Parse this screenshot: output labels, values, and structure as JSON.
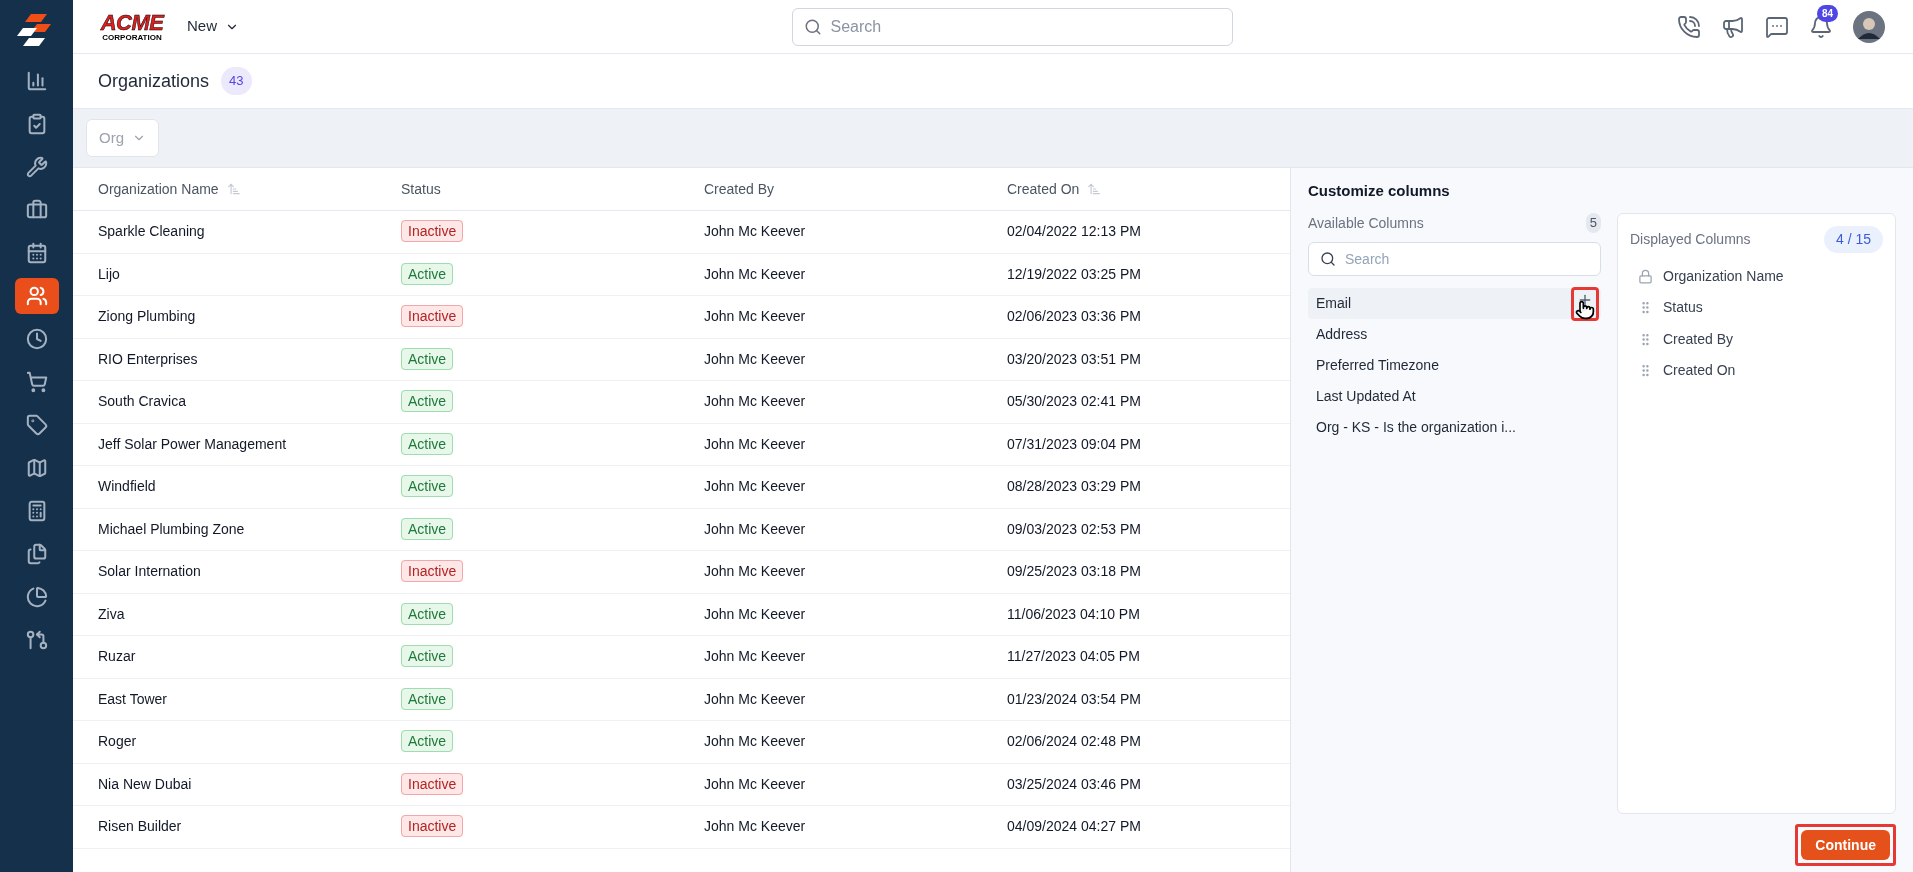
{
  "sidebar": {
    "items": [
      {
        "selected": false
      },
      {
        "selected": false
      },
      {
        "selected": false
      },
      {
        "selected": false
      },
      {
        "selected": false
      },
      {
        "selected": true
      },
      {
        "selected": false
      },
      {
        "selected": false
      },
      {
        "selected": false
      },
      {
        "selected": false
      },
      {
        "selected": false
      },
      {
        "selected": false
      },
      {
        "selected": false
      },
      {
        "selected": false
      }
    ]
  },
  "header": {
    "logo": {
      "title": "ACME",
      "subtitle": "CORPORATION"
    },
    "new_menu": "New",
    "search": {
      "placeholder": "Search"
    },
    "notifications_badge": "84"
  },
  "page": {
    "title": "Organizations",
    "count": "43",
    "filter": "Org"
  },
  "table": {
    "columns": [
      {
        "label": "Organization Name",
        "sortable": true
      },
      {
        "label": "Status",
        "sortable": false
      },
      {
        "label": "Created By",
        "sortable": false
      },
      {
        "label": "Created On",
        "sortable": true
      }
    ],
    "rows": [
      {
        "name": "Sparkle Cleaning",
        "status": "Inactive",
        "active": false,
        "created_by": "John Mc Keever",
        "created_on": "02/04/2022 12:13 PM"
      },
      {
        "name": "Lijo",
        "status": "Active",
        "active": true,
        "created_by": "John Mc Keever",
        "created_on": "12/19/2022 03:25 PM"
      },
      {
        "name": "Ziong Plumbing",
        "status": "Inactive",
        "active": false,
        "created_by": "John Mc Keever",
        "created_on": "02/06/2023 03:36 PM"
      },
      {
        "name": "RIO Enterprises",
        "status": "Active",
        "active": true,
        "created_by": "John Mc Keever",
        "created_on": "03/20/2023 03:51 PM"
      },
      {
        "name": "South Cravica",
        "status": "Active",
        "active": true,
        "created_by": "John Mc Keever",
        "created_on": "05/30/2023 02:41 PM"
      },
      {
        "name": "Jeff Solar Power Management",
        "status": "Active",
        "active": true,
        "created_by": "John Mc Keever",
        "created_on": "07/31/2023 09:04 PM"
      },
      {
        "name": "Windfield",
        "status": "Active",
        "active": true,
        "created_by": "John Mc Keever",
        "created_on": "08/28/2023 03:29 PM"
      },
      {
        "name": "Michael Plumbing Zone",
        "status": "Active",
        "active": true,
        "created_by": "John Mc Keever",
        "created_on": "09/03/2023 02:53 PM"
      },
      {
        "name": "Solar Internation",
        "status": "Inactive",
        "active": false,
        "created_by": "John Mc Keever",
        "created_on": "09/25/2023 03:18 PM"
      },
      {
        "name": "Ziva",
        "status": "Active",
        "active": true,
        "created_by": "John Mc Keever",
        "created_on": "11/06/2023 04:10 PM"
      },
      {
        "name": "Ruzar",
        "status": "Active",
        "active": true,
        "created_by": "John Mc Keever",
        "created_on": "11/27/2023 04:05 PM"
      },
      {
        "name": "East Tower",
        "status": "Active",
        "active": true,
        "created_by": "John Mc Keever",
        "created_on": "01/23/2024 03:54 PM"
      },
      {
        "name": "Roger",
        "status": "Active",
        "active": true,
        "created_by": "John Mc Keever",
        "created_on": "02/06/2024 02:48 PM"
      },
      {
        "name": "Nia New Dubai",
        "status": "Inactive",
        "active": false,
        "created_by": "John Mc Keever",
        "created_on": "03/25/2024 03:46 PM"
      },
      {
        "name": "Risen Builder",
        "status": "Inactive",
        "active": false,
        "created_by": "John Mc Keever",
        "created_on": "04/09/2024 04:27 PM"
      }
    ]
  },
  "customize": {
    "title": "Customize columns",
    "available": {
      "label": "Available Columns",
      "count": "5",
      "search": {
        "placeholder": "Search"
      },
      "items": [
        {
          "label": "Email",
          "selected": true
        },
        {
          "label": "Address",
          "selected": false
        },
        {
          "label": "Preferred Timezone",
          "selected": false
        },
        {
          "label": "Last Updated At",
          "selected": false
        },
        {
          "label": "Org - KS - Is the organization i...",
          "selected": false
        }
      ]
    },
    "displayed": {
      "label": "Displayed Columns",
      "count": "4 / 15",
      "items": [
        {
          "label": "Organization Name",
          "locked": true
        },
        {
          "label": "Status",
          "locked": false
        },
        {
          "label": "Created By",
          "locked": false
        },
        {
          "label": "Created On",
          "locked": false
        }
      ]
    },
    "continue_button": "Continue"
  }
}
